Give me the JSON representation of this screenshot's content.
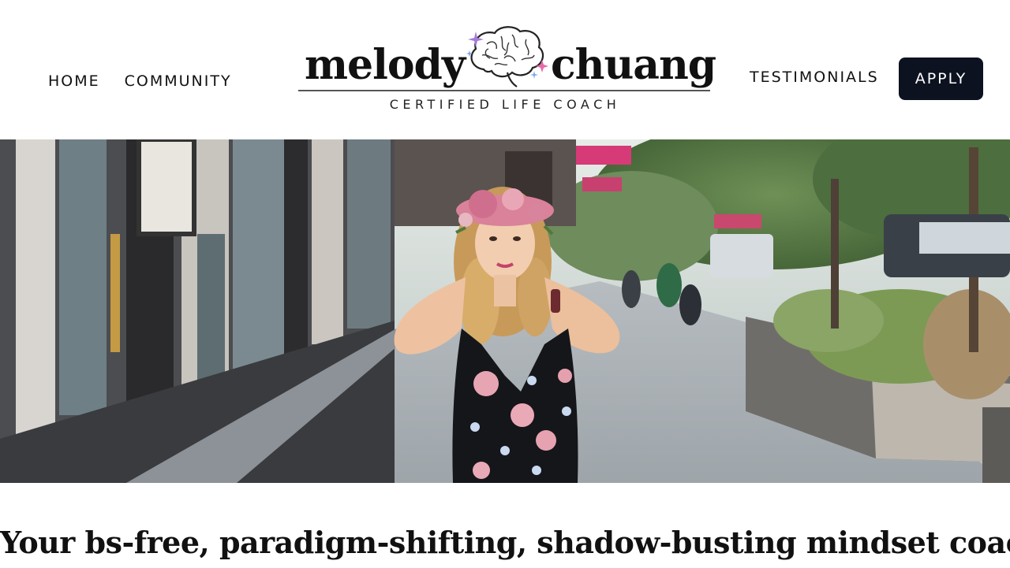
{
  "nav": {
    "left": [
      {
        "label": "HOME"
      },
      {
        "label": "COMMUNITY"
      }
    ],
    "right": {
      "testimonials": "TESTIMONIALS",
      "apply": "APPLY"
    }
  },
  "logo": {
    "word_left": "melody",
    "word_right": "chuang",
    "subtitle": "CERTIFIED LIFE COACH",
    "icon": "brain-icon"
  },
  "hero": {
    "alt_icon": "hero-photo"
  },
  "tagline": "Your bs-free, paradigm-shifting, shadow-busting mindset coach",
  "colors": {
    "apply_bg": "#0c1220",
    "text": "#111111",
    "sparkle_purple": "#a77ad8",
    "sparkle_pink": "#e76aa8",
    "sparkle_blue": "#7da7e8"
  }
}
